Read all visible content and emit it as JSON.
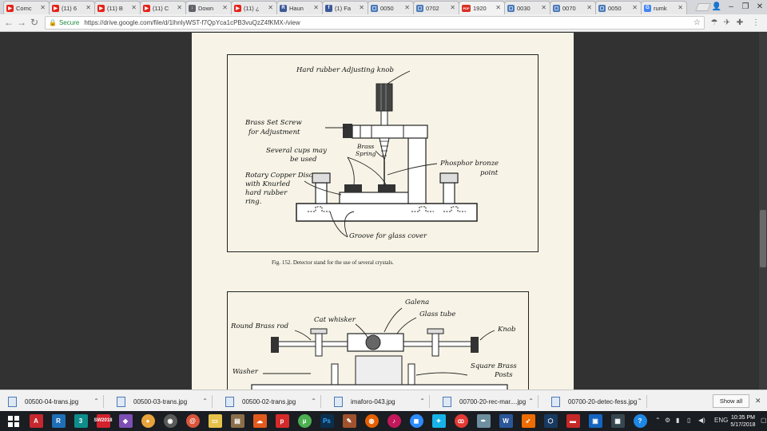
{
  "tabs": [
    {
      "label": "Comc",
      "color": "#e62117",
      "glyph": "▶"
    },
    {
      "label": "(11) 6",
      "color": "#e62117",
      "glyph": "▶"
    },
    {
      "label": "(11) B",
      "color": "#e62117",
      "glyph": "▶"
    },
    {
      "label": "(11) C",
      "color": "#e62117",
      "glyph": "▶"
    },
    {
      "label": "Down",
      "color": "#5f6368",
      "glyph": "↓"
    },
    {
      "label": "(11) ¿",
      "color": "#e62117",
      "glyph": "▶"
    },
    {
      "label": "Haun",
      "color": "#3b5998",
      "glyph": "R"
    },
    {
      "label": "(1) Fa",
      "color": "#3b5998",
      "glyph": "f"
    },
    {
      "label": "0050",
      "color": "#4a79b8",
      "glyph": "▢"
    },
    {
      "label": "0702",
      "color": "#4a79b8",
      "glyph": "▢"
    },
    {
      "label": "1920",
      "color": "#d93025",
      "glyph": "PDF"
    },
    {
      "label": "0030",
      "color": "#4a79b8",
      "glyph": "▢"
    },
    {
      "label": "0070",
      "color": "#4a79b8",
      "glyph": "▢"
    },
    {
      "label": "0050",
      "color": "#4a79b8",
      "glyph": "▢"
    },
    {
      "label": "rumk",
      "color": "#4285f4",
      "glyph": "G"
    }
  ],
  "toolbar": {
    "secure_label": "Secure",
    "url": "https://drive.google.com/file/d/1lhnlyWST-f7QpYca1cPB3vuQzZ4fKMX-/view"
  },
  "figure152": {
    "labels": {
      "knob": "Hard rubber Adjusting knob",
      "set_screw_1": "Brass Set Screw",
      "set_screw_2": "for Adjustment",
      "cups_1": "Several cups may",
      "cups_2": "be used",
      "spring_1": "Brass",
      "spring_2": "Spring",
      "point_1": "Phosphor bronze",
      "point_2": "point",
      "disc_1": "Rotary Copper Disc",
      "disc_2": "with Knurled",
      "disc_3": "hard rubber",
      "disc_4": "ring.",
      "groove": "Groove for glass cover"
    },
    "caption": "Fig. 152.   Detector stand for the use of several crystals."
  },
  "figure2": {
    "labels": {
      "galena": "Galena",
      "glass_tube": "Glass tube",
      "cat_whisker": "Cat whisker",
      "rod": "Round Brass rod",
      "knob": "Knob",
      "washer": "Washer",
      "posts_1": "Square Brass",
      "posts_2": "Posts"
    }
  },
  "downloads": [
    "00500-04-trans.jpg",
    "00500-03-trans.jpg",
    "00500-02-trans.jpg",
    "imaforo-043.jpg",
    "00700-20-rec-mar....jpg",
    "00700-20-detec-fess.jpg"
  ],
  "downloads_show_all": "Show all",
  "taskbar": {
    "lang": "ENG",
    "time": "10:35 PM",
    "date": "5/17/2018",
    "sw_year": "2018"
  }
}
